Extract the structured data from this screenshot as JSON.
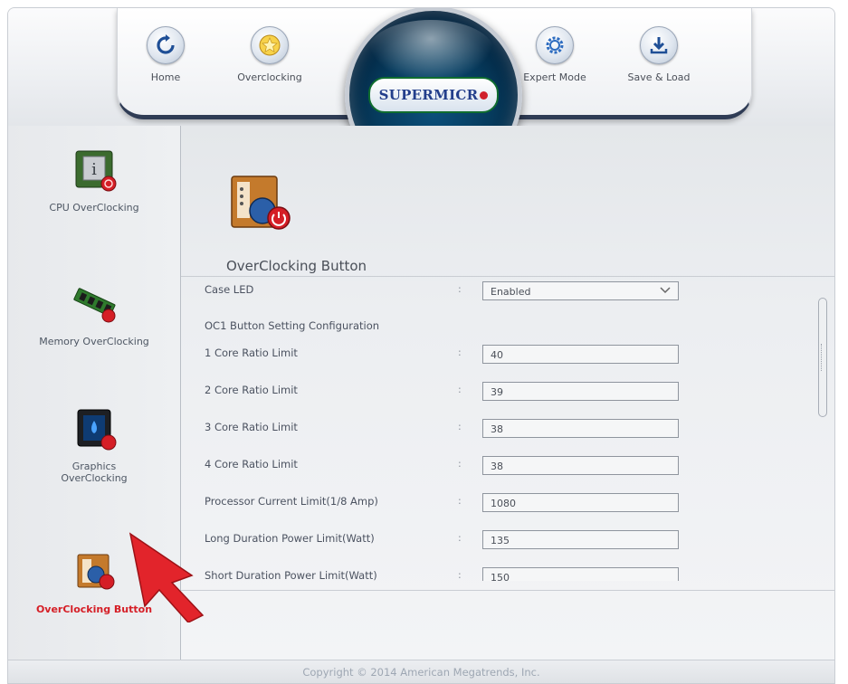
{
  "nav": {
    "home": "Home",
    "overclocking": "Overclocking",
    "expert_mode": "Expert Mode",
    "save_load": "Save & Load"
  },
  "logo": {
    "text": "SUPERMICR"
  },
  "sidebar": {
    "items": [
      {
        "label": "CPU OverClocking",
        "icon": "cpu-chip-icon"
      },
      {
        "label": "Memory OverClocking",
        "icon": "memory-module-icon"
      },
      {
        "label": "Graphics OverClocking",
        "icon": "graphics-chip-icon"
      },
      {
        "label": "OverClocking Button",
        "icon": "overclocking-button-icon",
        "active": true
      }
    ]
  },
  "page": {
    "title": "OverClocking Button"
  },
  "settings": {
    "case_led": {
      "label": "Case LED",
      "value": "Enabled"
    },
    "section": "OC1 Button Setting Configuration",
    "rows": [
      {
        "label": "1 Core Ratio Limit",
        "value": "40"
      },
      {
        "label": "2 Core Ratio Limit",
        "value": "39"
      },
      {
        "label": "3 Core Ratio Limit",
        "value": "38"
      },
      {
        "label": "4 Core Ratio Limit",
        "value": "38"
      },
      {
        "label": "Processor Current Limit(1/8 Amp)",
        "value": "1080"
      },
      {
        "label": "Long Duration Power Limit(Watt)",
        "value": "135"
      },
      {
        "label": "Short Duration Power Limit(Watt)",
        "value": "150"
      }
    ]
  },
  "footer": {
    "copyright": "Copyright © 2014 American Megatrends, Inc."
  },
  "colors": {
    "accent_red": "#d51e26",
    "nav_dark": "#2f3c55"
  }
}
